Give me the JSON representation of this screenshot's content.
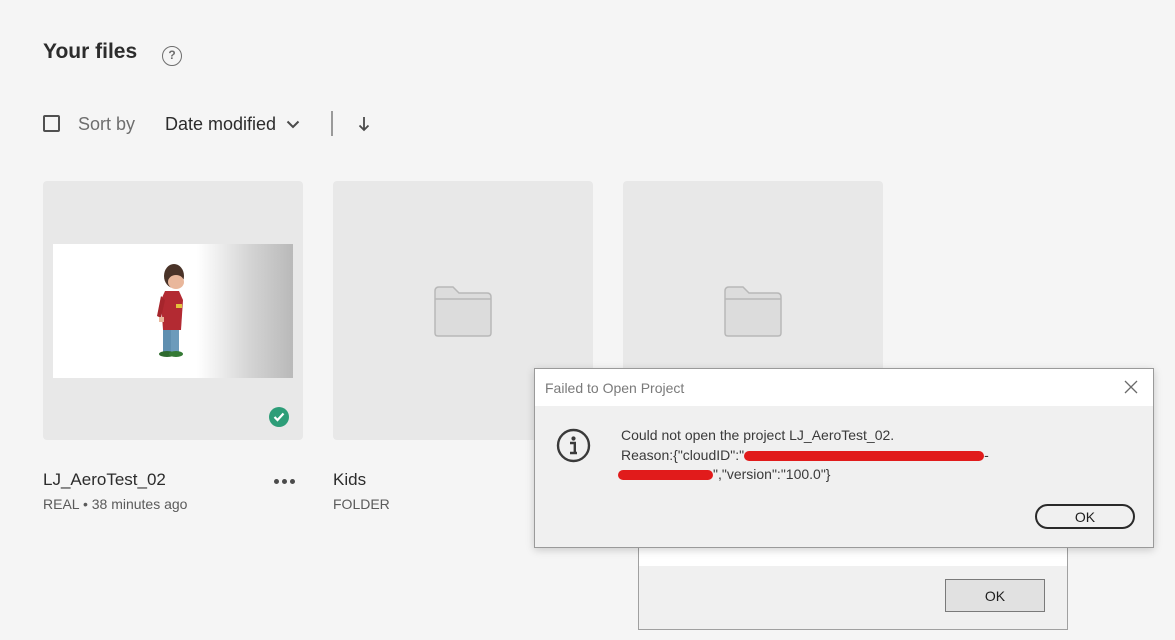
{
  "header": {
    "title": "Your files",
    "help_icon": "question-icon"
  },
  "toolbar": {
    "sort_label": "Sort by",
    "sort_value": "Date modified",
    "sort_direction_icon": "arrow-down-icon"
  },
  "files": [
    {
      "name": "LJ_AeroTest_02",
      "meta": "REAL • 38 minutes ago",
      "type": "file",
      "synced": true
    },
    {
      "name": "Kids",
      "meta": "FOLDER",
      "type": "folder"
    },
    {
      "name": "",
      "meta": "",
      "type": "folder"
    }
  ],
  "error_dialog": {
    "title": "Failed to Open Project",
    "line1": "Could not open the project LJ_AeroTest_02.",
    "line2_prefix": "Reason:{\"cloudID\":\"",
    "line2_suffix": "-",
    "line3_suffix": "\",\"version\":\"100.0\"}",
    "ok_label": "OK",
    "icon": "info-icon"
  },
  "background_dialog": {
    "ok_label": "OK"
  },
  "colors": {
    "background": "#f5f5f5",
    "card": "#e8e8e8",
    "sync_badge": "#2d9d78",
    "redaction": "#e11b1b"
  }
}
